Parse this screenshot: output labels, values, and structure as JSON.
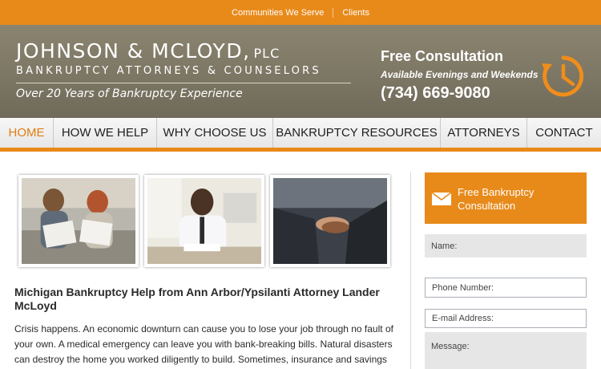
{
  "topbar": {
    "links": [
      "Communities We Serve",
      "Clients"
    ]
  },
  "header": {
    "firm_name": "JOHNSON & MCLOYD,",
    "firm_suffix": "PLC",
    "firm_sub": "BANKRUPTCY ATTORNEYS & COUNSELORS",
    "tagline": "Over 20 Years of Bankruptcy Experience",
    "consult_title": "Free Consultation",
    "consult_hours": "Available Evenings and Weekends",
    "phone": "(734) 669-9080"
  },
  "nav": {
    "items": [
      "HOME",
      "HOW WE HELP",
      "WHY CHOOSE US",
      "BANKRUPTCY RESOURCES",
      "ATTORNEYS",
      "CONTACT"
    ],
    "active": "HOME"
  },
  "main": {
    "headline": "Michigan Bankruptcy Help from Ann Arbor/Ypsilanti Attorney Lander McLoyd",
    "body": "Crisis happens. An economic downturn can cause you to lose your job through no fault of your own. A medical emergency can leave you with bank-breaking bills. Natural disasters can destroy the home you worked diligently to build. Sometimes, insurance and savings are just"
  },
  "sidebar": {
    "cta_label": "Free Bankruptcy Consultation",
    "fields": {
      "name": "Name:",
      "phone": "Phone Number:",
      "email": "E-mail Address:",
      "message": "Message:"
    }
  },
  "colors": {
    "accent": "#e88a1a",
    "header_bg": "#7b7563",
    "nav_active": "#e07d12"
  },
  "icons": {
    "clock": "clock-icon",
    "mail": "mail-icon"
  }
}
